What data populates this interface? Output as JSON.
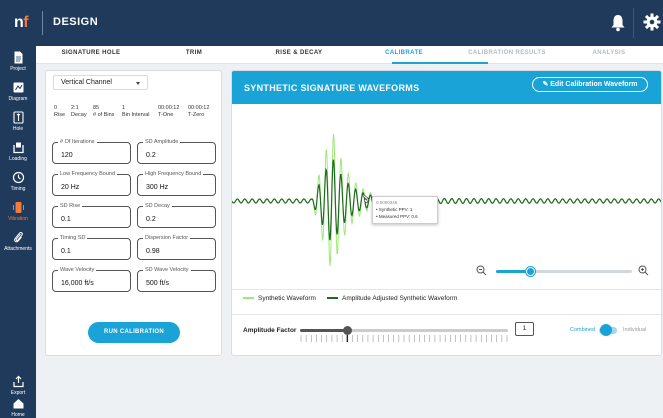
{
  "header": {
    "logo_n": "n",
    "logo_f": "f",
    "title": "DESIGN",
    "bell_icon": "bell-icon",
    "gear_icon": "gear-icon"
  },
  "sidebar": {
    "items": [
      {
        "label": "Project",
        "icon": "document-icon",
        "active": false
      },
      {
        "label": "Diagram",
        "icon": "diagram-icon",
        "active": false
      },
      {
        "label": "Hole",
        "icon": "hole-icon",
        "active": false
      },
      {
        "label": "Loading",
        "icon": "loading-icon",
        "active": false
      },
      {
        "label": "Timing",
        "icon": "clock-icon",
        "active": false
      },
      {
        "label": "Vibration",
        "icon": "vibration-icon",
        "active": true
      },
      {
        "label": "Attachments",
        "icon": "paperclip-icon",
        "active": false
      }
    ],
    "bottom_items": [
      {
        "label": "Export",
        "icon": "export-icon"
      },
      {
        "label": "Home",
        "icon": "home-icon"
      }
    ]
  },
  "tabs": [
    {
      "label": "SIGNATURE HOLE",
      "state": "normal"
    },
    {
      "label": "TRIM",
      "state": "normal"
    },
    {
      "label": "RISE & DECAY",
      "state": "normal"
    },
    {
      "label": "CALIBRATE",
      "state": "active"
    },
    {
      "label": "CALIBRATION RESULTS",
      "state": "disabled"
    },
    {
      "label": "ANALYSIS",
      "state": "disabled"
    }
  ],
  "channel_select": {
    "value": "Vertical Channel"
  },
  "stats": [
    {
      "value": "0",
      "label": "Rise"
    },
    {
      "value": "2:1",
      "label": "Decay"
    },
    {
      "value": "85",
      "label": "# of Bins"
    },
    {
      "value": "1",
      "label": "Bin Interval"
    },
    {
      "value": "00:00:12",
      "label": "T-One"
    },
    {
      "value": "00:00:12",
      "label": "T-Zero"
    }
  ],
  "fields": [
    {
      "label": "# Of Iterations",
      "value": "120"
    },
    {
      "label": "SD Amplitude",
      "value": "0.2"
    },
    {
      "label": "Low Frequency Bound",
      "value": "20 Hz"
    },
    {
      "label": "High Frequency Bound",
      "value": "300 Hz"
    },
    {
      "label": "SD Rise",
      "value": "0.1"
    },
    {
      "label": "SD Decay",
      "value": "0.2"
    },
    {
      "label": "Timing SD",
      "value": "0.1"
    },
    {
      "label": "Dispersion Factor",
      "value": "0.98"
    },
    {
      "label": "Wave Velocity",
      "value": "16,000 ft/s"
    },
    {
      "label": "SD Wave Velocity",
      "value": "500 ft/s"
    }
  ],
  "run_button": {
    "label": "RUN CALIBRATION"
  },
  "waveform": {
    "title": "SYNTHETIC SIGNATURE WAVEFORMS",
    "edit_button": "Edit Calibration Waveform",
    "colors": {
      "synthetic": "#9fe87a",
      "adjusted": "#1f6b1f",
      "accent": "#1aa3d6"
    },
    "tooltip": {
      "title": "0.0000346",
      "line1": "• Synthetic PPV: 1",
      "line2": "• Measured PPV: 0.6"
    },
    "zoom_level": 0.25,
    "legend": {
      "synthetic": "Synthetic Waveform",
      "adjusted": "Amplitude Adjusted Synthetic Waveform"
    }
  },
  "amplitude": {
    "label": "Amplitude Factor",
    "value": "1",
    "slider_fraction": 0.23
  },
  "toggle": {
    "left_label": "Combined",
    "right_label": "Individual",
    "state": "Combined"
  }
}
